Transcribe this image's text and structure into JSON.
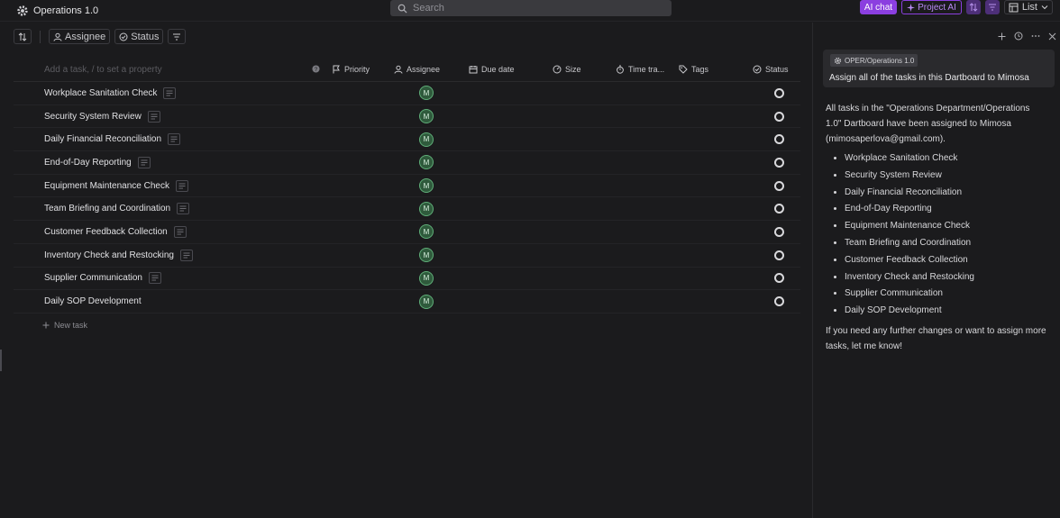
{
  "app": {
    "title": "Operations 1.0"
  },
  "search": {
    "placeholder": "Search"
  },
  "topbar": {
    "ai_chat": "AI chat",
    "project_ai": "Project AI",
    "view": "List"
  },
  "filters": {
    "assignee": "Assignee",
    "status": "Status"
  },
  "table": {
    "add_placeholder": "Add a task, / to set a property",
    "columns": {
      "priority": "Priority",
      "assignee": "Assignee",
      "due_date": "Due date",
      "size": "Size",
      "time": "Time tra...",
      "tags": "Tags",
      "status": "Status"
    },
    "tasks": [
      {
        "title": "Workplace Sanitation Check",
        "assignee": "M",
        "has_desc": true
      },
      {
        "title": "Security System Review",
        "assignee": "M",
        "has_desc": true
      },
      {
        "title": "Daily Financial Reconciliation",
        "assignee": "M",
        "has_desc": true
      },
      {
        "title": "End-of-Day Reporting",
        "assignee": "M",
        "has_desc": true
      },
      {
        "title": "Equipment Maintenance Check",
        "assignee": "M",
        "has_desc": true
      },
      {
        "title": "Team Briefing and Coordination",
        "assignee": "M",
        "has_desc": true
      },
      {
        "title": "Customer Feedback Collection",
        "assignee": "M",
        "has_desc": true
      },
      {
        "title": "Inventory Check and Restocking",
        "assignee": "M",
        "has_desc": true
      },
      {
        "title": "Supplier Communication",
        "assignee": "M",
        "has_desc": true
      },
      {
        "title": "Daily SOP Development",
        "assignee": "M",
        "has_desc": false
      }
    ],
    "new_task": "New task"
  },
  "chat": {
    "context_chip": "OPER/Operations 1.0",
    "prompt": "Assign all of the tasks in this Dartboard to Mimosa",
    "response_intro": "All tasks in the \"Operations Department/Operations 1.0\" Dartboard have been assigned to Mimosa (mimosaperlova@gmail.com).",
    "response_items": [
      "Workplace Sanitation Check",
      "Security System Review",
      "Daily Financial Reconciliation",
      "End-of-Day Reporting",
      "Equipment Maintenance Check",
      "Team Briefing and Coordination",
      "Customer Feedback Collection",
      "Inventory Check and Restocking",
      "Supplier Communication",
      "Daily SOP Development"
    ],
    "response_outro": "If you need any further changes or want to assign more tasks, let me know!"
  },
  "colors": {
    "accent": "#8b3fe0",
    "avatar": "#2f5a3c",
    "background": "#1b1b1d"
  }
}
